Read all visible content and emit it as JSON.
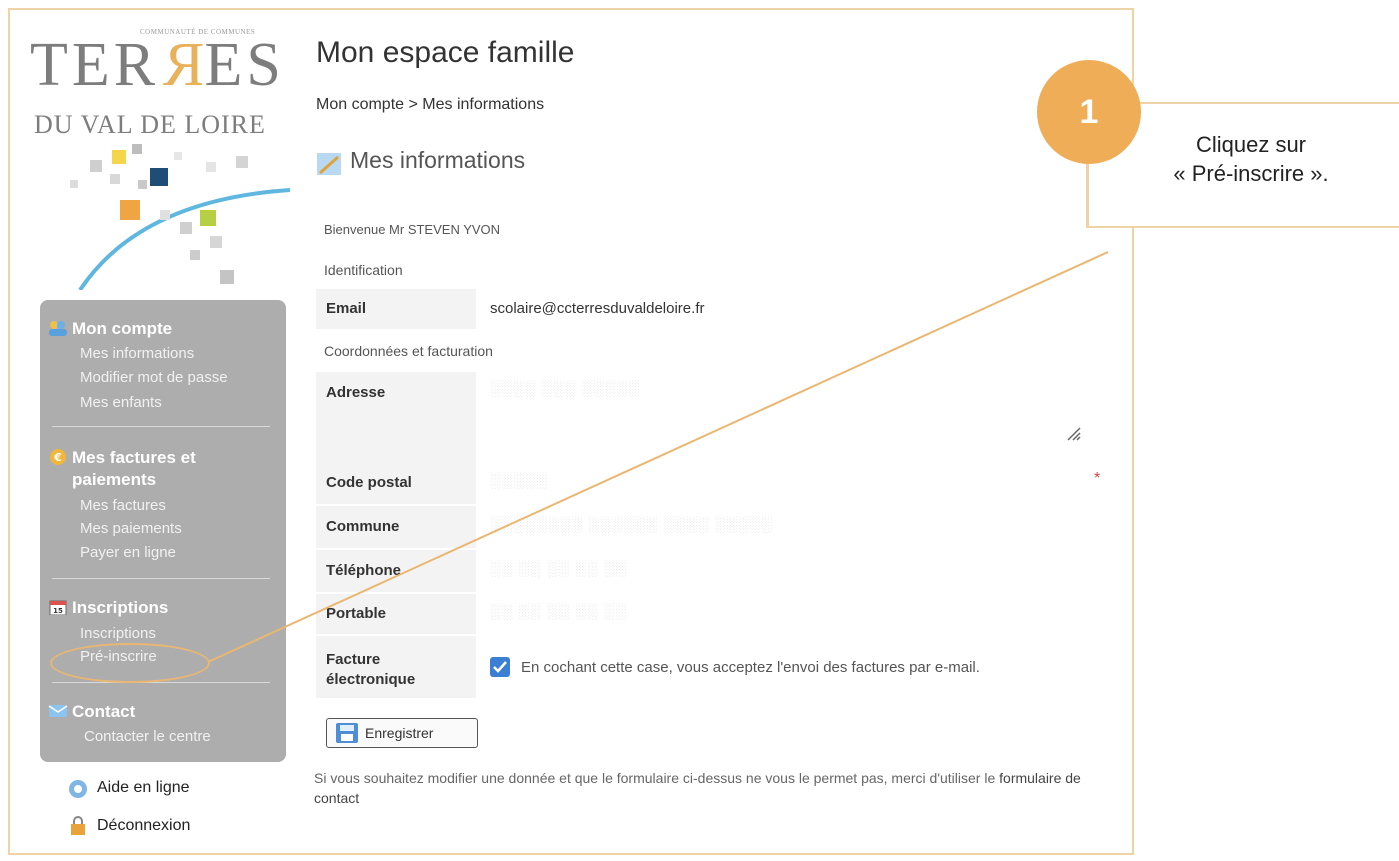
{
  "logo": {
    "small_text": "COMMUNAUTÉ DE COMMUNES",
    "title_left": "TER",
    "title_r": "R",
    "title_right": "ES",
    "subtitle": "DU VAL DE LOIRE"
  },
  "sidebar": {
    "sections": [
      {
        "title": "Mon compte",
        "icon": "users-icon",
        "items": [
          "Mes informations",
          "Modifier mot de passe",
          "Mes enfants"
        ]
      },
      {
        "title_line1": "Mes factures et",
        "title_line2": "paiements",
        "icon": "euro-icon",
        "items": [
          "Mes factures",
          "Mes paiements",
          "Payer en ligne"
        ]
      },
      {
        "title": "Inscriptions",
        "icon": "calendar-icon",
        "items": [
          "Inscriptions",
          "Pré-inscrire"
        ]
      },
      {
        "title": "Contact",
        "icon": "contact-icon",
        "items": [
          "Contacter le centre"
        ]
      }
    ],
    "help": "Aide en ligne",
    "logout": "Déconnexion"
  },
  "header": {
    "title": "Mon espace famille",
    "breadcrumb_account": "Mon compte",
    "breadcrumb_sep": " > ",
    "breadcrumb_page": "Mes informations"
  },
  "main": {
    "section_title": "Mes informations",
    "welcome": "Bienvenue Mr STEVEN YVON",
    "identification": "Identification",
    "email_label": "Email",
    "email_value": "scolaire@ccterresduvaldeloire.fr",
    "coords_label": "Coordonnées et facturation",
    "address_label": "Adresse",
    "postal_label": "Code postal",
    "city_label": "Commune",
    "phone_label": "Téléphone",
    "mobile_label": "Portable",
    "invoice_label_1": "Facture",
    "invoice_label_2": "électronique",
    "invoice_checked": true,
    "invoice_text": "En cochant cette case, vous acceptez l'envoi des factures par e-mail.",
    "required_mark": "*",
    "save_label": "Enregistrer",
    "note_text": "Si vous souhaitez modifier une donnée et que le formulaire ci-dessus ne vous le permet pas, merci d'utiliser le ",
    "note_link": "formulaire de contact"
  },
  "callout": {
    "number": "1",
    "line1": "Cliquez sur",
    "line2": "« Pré-inscrire »."
  },
  "colors": {
    "accent_orange": "#efad58",
    "frame_border": "#efd3a5",
    "sidebar_bg": "#adadad",
    "checkbox_blue": "#3b7fd4"
  }
}
